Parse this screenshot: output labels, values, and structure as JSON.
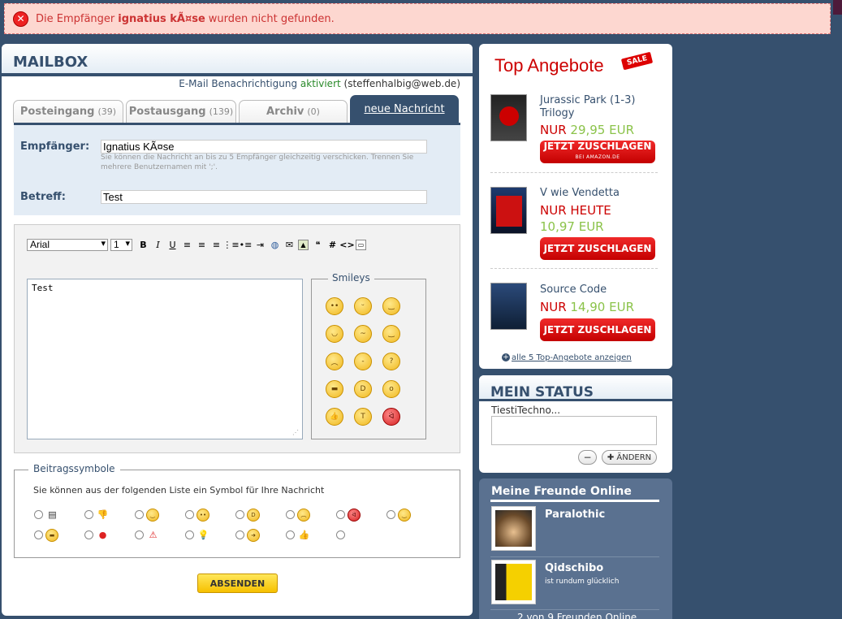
{
  "error": {
    "before": "Die Empfänger",
    "name": "ignatius kÃ¤se",
    "after": "wurden nicht gefunden."
  },
  "mailbox": {
    "title": "MAILBOX",
    "notify_label": "E-Mail Benachrichtigung",
    "notify_state": "aktiviert",
    "notify_email": "(steffenhalbig@web.de)",
    "tabs": [
      {
        "label": "Posteingang",
        "count": "(39)"
      },
      {
        "label": "Postausgang",
        "count": "(139)"
      },
      {
        "label": "Archiv",
        "count": "(0)"
      },
      {
        "label": "neue Nachricht"
      }
    ],
    "recipient_label": "Empfänger:",
    "recipient_value": "Ignatius KÃ¤se",
    "recipient_hint": "Sie können die Nachricht an bis zu 5 Empfänger gleichzeitig verschicken. Trennen Sie mehrere Benutzernamen mit ';'.",
    "subject_label": "Betreff:",
    "subject_value": "Test",
    "font_family": "Arial",
    "font_size": "1",
    "message": "Test",
    "smileys_title": "Smileys",
    "symbols_title": "Beitragssymbole",
    "symbols_hint": "Sie können aus der folgenden Liste ein Symbol für Ihre Nachricht",
    "submit_label": "ABSENDEN"
  },
  "top_offers": {
    "title": "Top Angebote",
    "sale_badge": "SALE",
    "items": [
      {
        "title": "Jurassic Park (1-3) Trilogy",
        "nur": "NUR",
        "price": "29,95 EUR",
        "button": "JETZT ZUSCHLAGEN",
        "button_sub": "BEI AMAZON.DE"
      },
      {
        "title": "V wie Vendetta",
        "nur": "NUR HEUTE",
        "price": "10,97 EUR",
        "button": "JETZT ZUSCHLAGEN"
      },
      {
        "title": "Source Code",
        "nur": "NUR",
        "price": "14,90 EUR",
        "button": "JETZT ZUSCHLAGEN"
      }
    ],
    "all_link": "alle 5 Top-Angebote anzeigen"
  },
  "status": {
    "title": "MEIN STATUS",
    "username": "TiestiTechno...",
    "minus": "−",
    "change": "✚ ÄNDERN"
  },
  "friends": {
    "title": "Meine Freunde Online",
    "list": [
      {
        "name": "Paralothic",
        "status": ""
      },
      {
        "name": "Qidschibo",
        "status": "ist rundum glücklich"
      }
    ],
    "count_text": "2 von 9 Freunden Online"
  }
}
